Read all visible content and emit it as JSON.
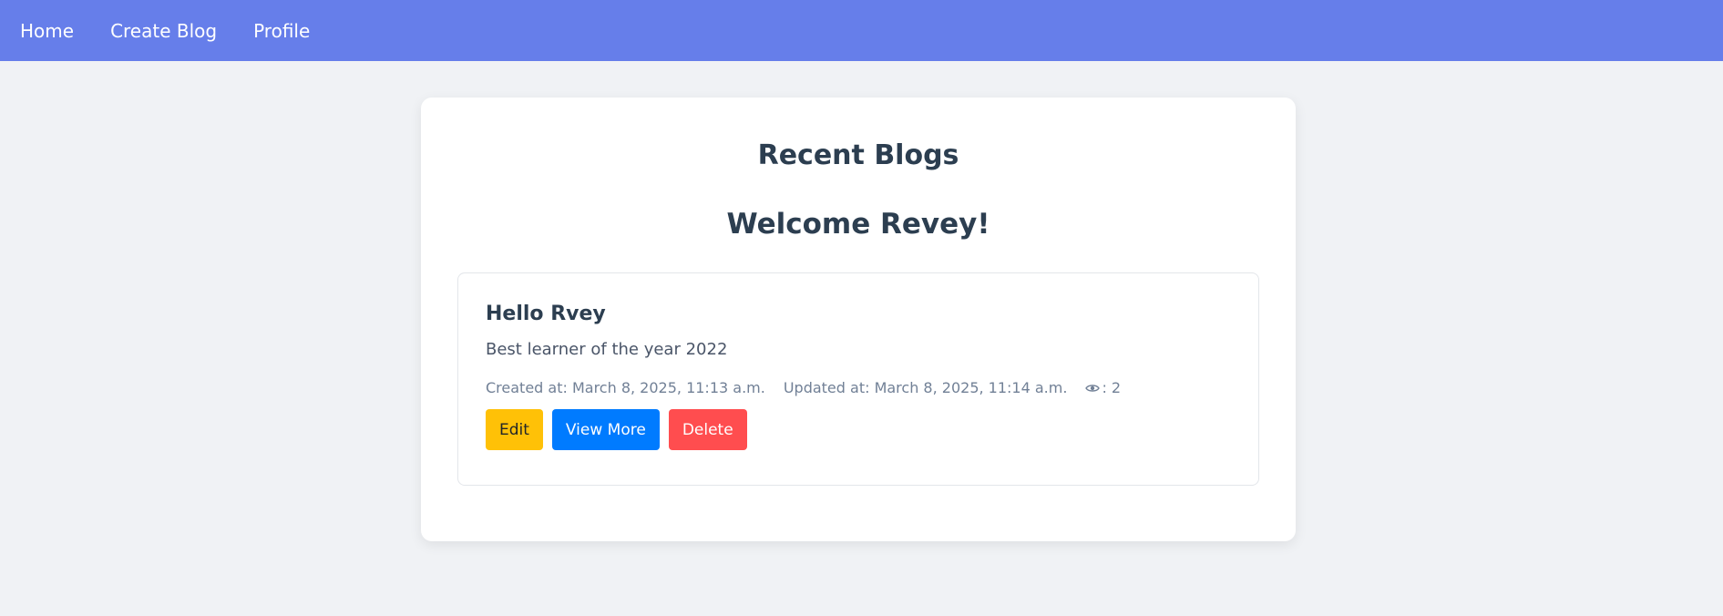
{
  "nav": {
    "items": [
      {
        "label": "Home"
      },
      {
        "label": "Create Blog"
      },
      {
        "label": "Profile"
      }
    ]
  },
  "main": {
    "heading": "Recent Blogs",
    "welcome": "Welcome Revey!"
  },
  "blog": {
    "title": "Hello Rvey",
    "description": "Best learner of the year 2022",
    "created": "Created at: March 8, 2025, 11:13 a.m.",
    "updated": "Updated at: March 8, 2025, 11:14 a.m.",
    "views": ": 2",
    "views_icon": "eye-icon",
    "actions": {
      "edit": "Edit",
      "view_more": "View More",
      "delete": "Delete"
    }
  },
  "colors": {
    "navbar": "#667eea",
    "edit": "#ffc107",
    "view_more": "#007bff",
    "delete": "#ff4d4f"
  }
}
